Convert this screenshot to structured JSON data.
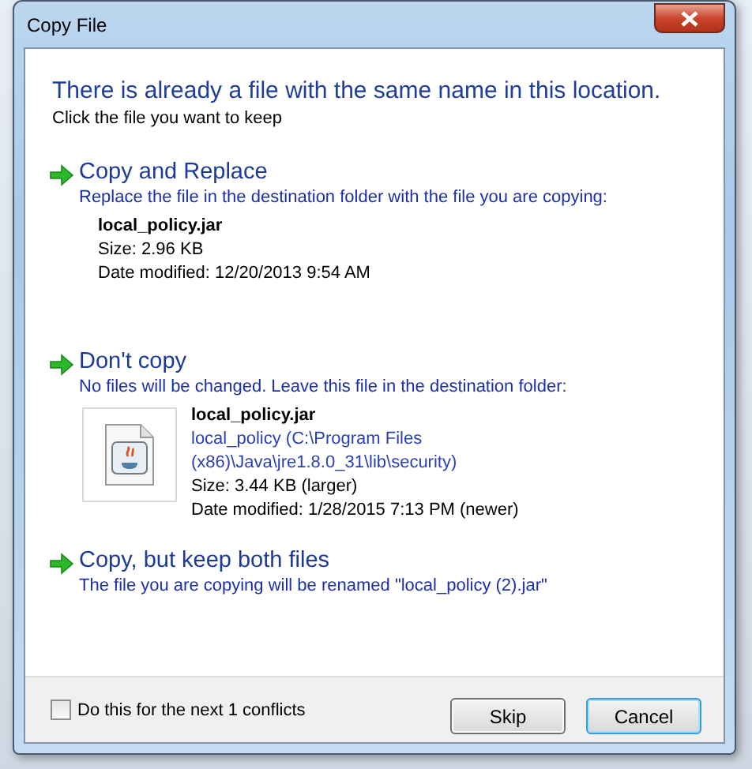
{
  "window": {
    "title": "Copy File"
  },
  "heading": "There is already a file with the same name in this location.",
  "subheading": "Click the file you want to keep",
  "options": [
    {
      "title": "Copy and Replace",
      "description": "Replace the file in the destination folder with the file you are copying:",
      "file": {
        "show_icon": false,
        "name": "local_policy.jar",
        "lines": [
          {
            "kind": "detail",
            "text": "Size: 2.96 KB"
          },
          {
            "kind": "detail",
            "text": "Date modified: 12/20/2013 9:54 AM"
          }
        ]
      }
    },
    {
      "title": "Don't copy",
      "description": "No files will be changed. Leave this file in the destination folder:",
      "file": {
        "show_icon": true,
        "name": "local_policy.jar",
        "lines": [
          {
            "kind": "path",
            "text": "local_policy (C:\\Program Files (x86)\\Java\\jre1.8.0_31\\lib\\security)"
          },
          {
            "kind": "detail",
            "text": "Size: 3.44 KB (larger)"
          },
          {
            "kind": "detail",
            "text": "Date modified: 1/28/2015 7:13 PM (newer)"
          }
        ]
      }
    },
    {
      "title": "Copy, but keep both files",
      "description": "The file you are copying will be renamed \"local_policy (2).jar\""
    }
  ],
  "footer": {
    "checkbox": {
      "label": "Do this for the next 1 conflicts",
      "checked": false
    },
    "buttons": [
      {
        "label": "Skip",
        "default": false
      },
      {
        "label": "Cancel",
        "default": true
      }
    ]
  }
}
